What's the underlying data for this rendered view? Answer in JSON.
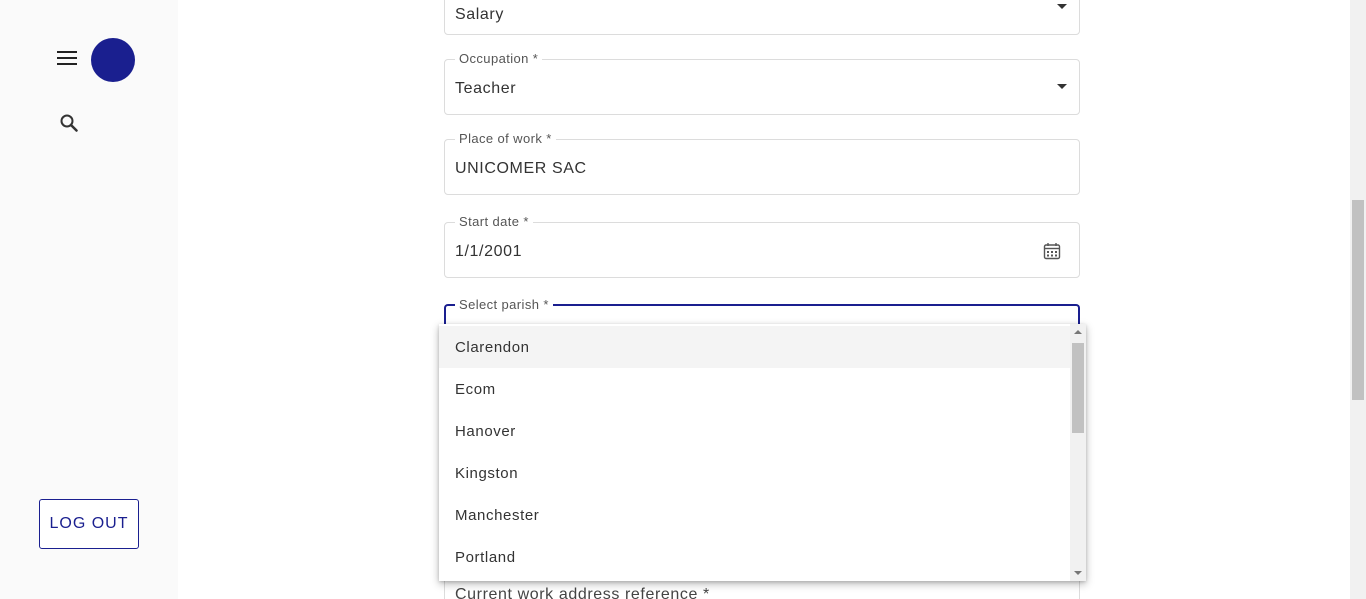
{
  "sidebar": {
    "menu_icon": "hamburger-menu-icon",
    "search_icon": "search-icon",
    "logout_label": "LOG OUT",
    "avatar_color": "#1a1f8f"
  },
  "form": {
    "salary": {
      "value": "Salary"
    },
    "occupation": {
      "label": "Occupation *",
      "value": "Teacher"
    },
    "place_of_work": {
      "label": "Place of work *",
      "value": "UNICOMER SAC"
    },
    "start_date": {
      "label": "Start date *",
      "value": "1/1/2001",
      "icon": "calendar-icon"
    },
    "parish": {
      "label": "Select parish *"
    },
    "work_address": {
      "label": "Current work address reference *"
    }
  },
  "parish_dropdown": {
    "options": [
      "Clarendon",
      "Ecom",
      "Hanover",
      "Kingston",
      "Manchester",
      "Portland"
    ],
    "highlighted": "Clarendon"
  },
  "colors": {
    "accent": "#1a1f8f",
    "border": "#dcdcdc",
    "background": "#fafafa"
  }
}
